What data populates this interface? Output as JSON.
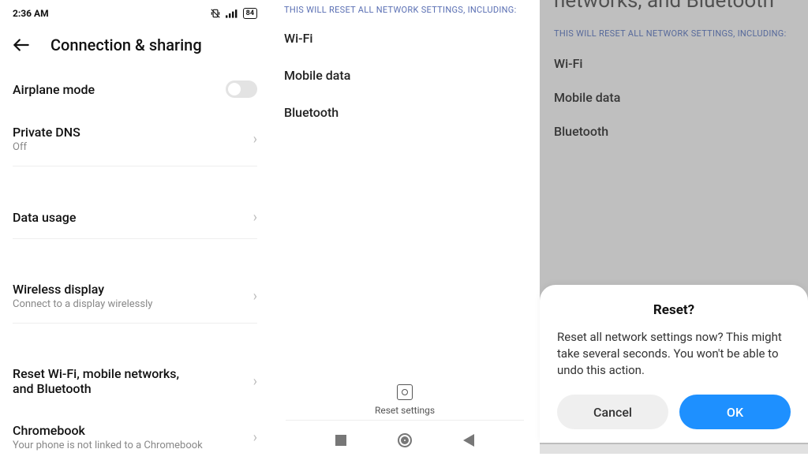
{
  "pane1": {
    "status": {
      "time": "2:36 AM",
      "battery": "84"
    },
    "title": "Connection & sharing",
    "rows": {
      "airplane": {
        "title": "Airplane mode"
      },
      "dns": {
        "title": "Private DNS",
        "sub": "Off"
      },
      "data": {
        "title": "Data usage"
      },
      "wireless": {
        "title": "Wireless display",
        "sub": "Connect to a display wirelessly"
      },
      "reset": {
        "title": "Reset Wi-Fi, mobile networks, and Bluetooth"
      },
      "chromebook": {
        "title": "Chromebook",
        "sub": "Your phone is not linked to a Chromebook"
      }
    }
  },
  "pane2": {
    "headnote": "THIS WILL RESET ALL NETWORK SETTINGS, INCLUDING:",
    "items": {
      "wifi": "Wi-Fi",
      "mobile": "Mobile data",
      "bt": "Bluetooth"
    },
    "reset_label": "Reset settings"
  },
  "pane3": {
    "toptitle": "networks, and Bluetooth",
    "headnote": "THIS WILL RESET ALL NETWORK SETTINGS, INCLUDING:",
    "items": {
      "wifi": "Wi-Fi",
      "mobile": "Mobile data",
      "bt": "Bluetooth"
    },
    "sheet": {
      "title": "Reset?",
      "body": "Reset all network settings now? This might take several seconds. You won't be able to undo this action.",
      "cancel": "Cancel",
      "ok": "OK"
    }
  }
}
